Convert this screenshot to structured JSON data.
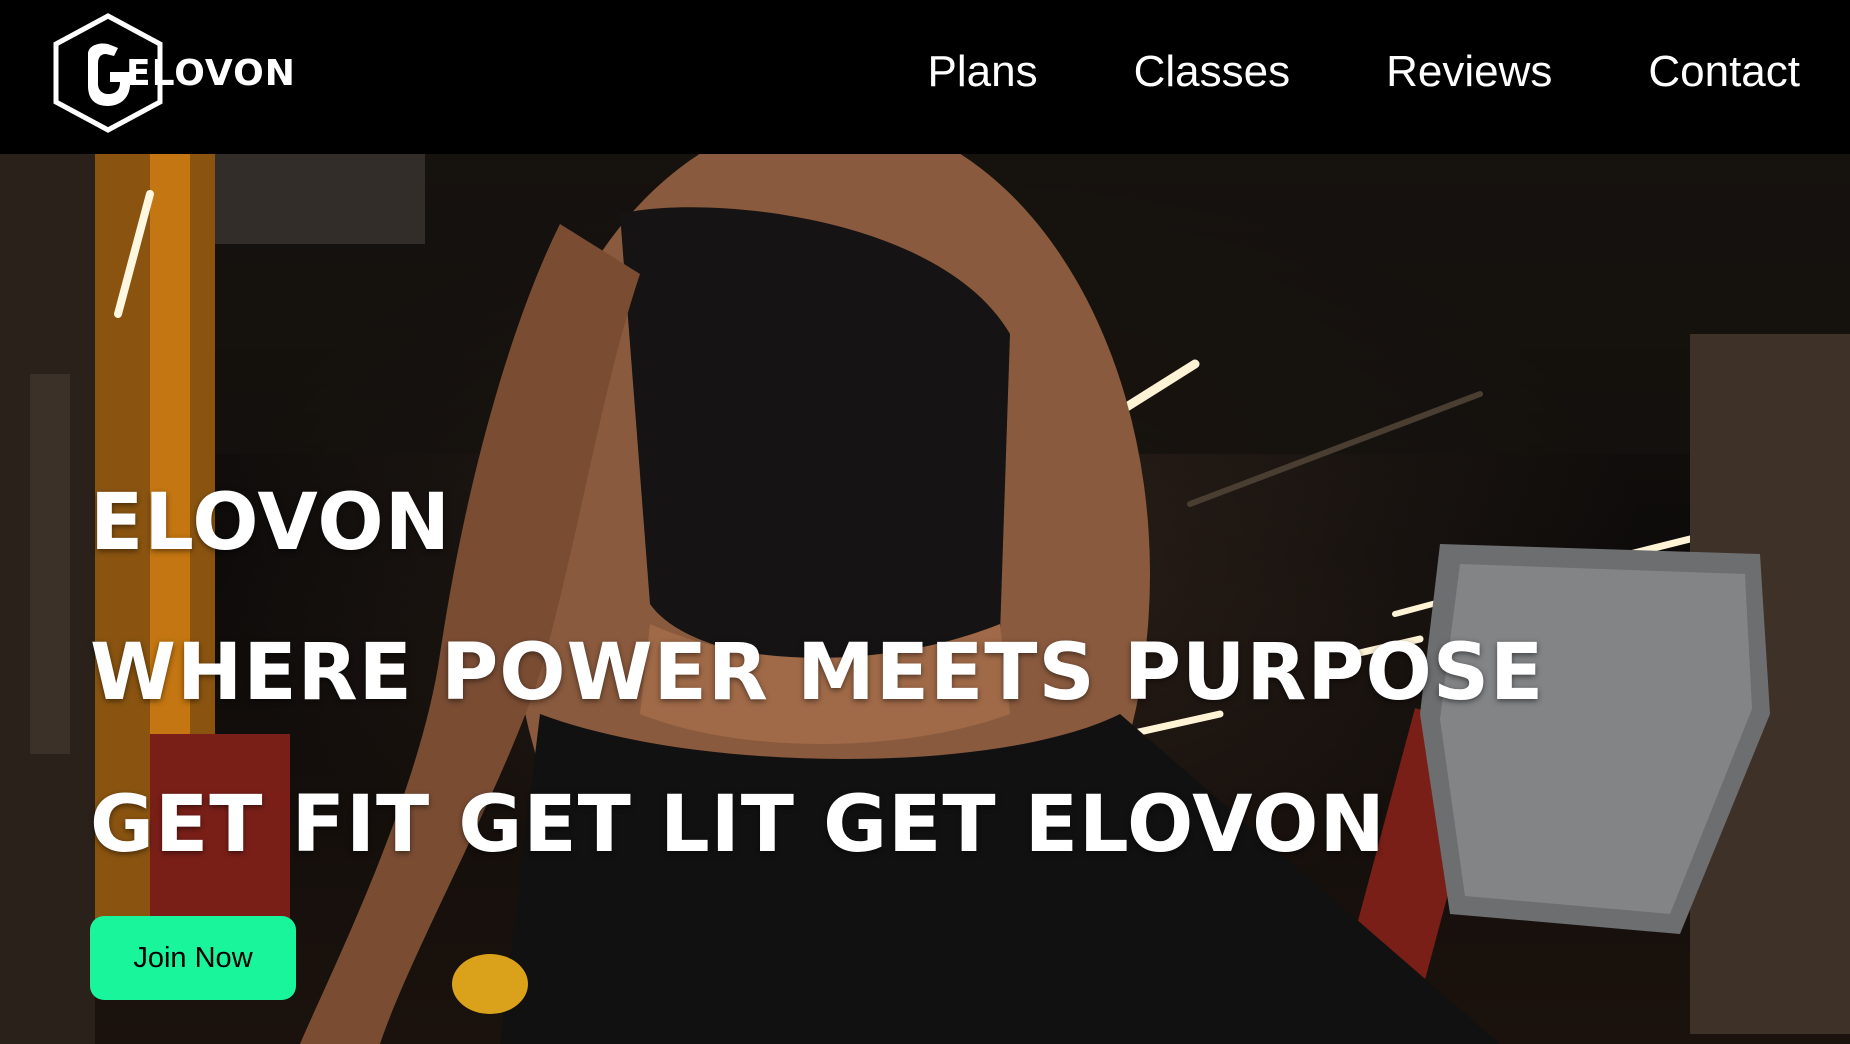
{
  "brand": {
    "name": "ELOVON"
  },
  "nav": {
    "items": [
      {
        "label": "Plans"
      },
      {
        "label": "Classes"
      },
      {
        "label": "Reviews"
      },
      {
        "label": "Contact"
      }
    ]
  },
  "hero": {
    "headline": "ELOVON",
    "tagline": "WHERE POWER MEETS PURPOSE",
    "slogan": "GET FIT GET LIT GET ELOVON",
    "cta_label": "Join Now",
    "background_scene": "woman-exercising-in-gym-photo"
  },
  "colors": {
    "nav_background": "#000000",
    "cta_background": "#19f59a",
    "cta_text": "#000000",
    "hero_text": "#ffffff"
  }
}
